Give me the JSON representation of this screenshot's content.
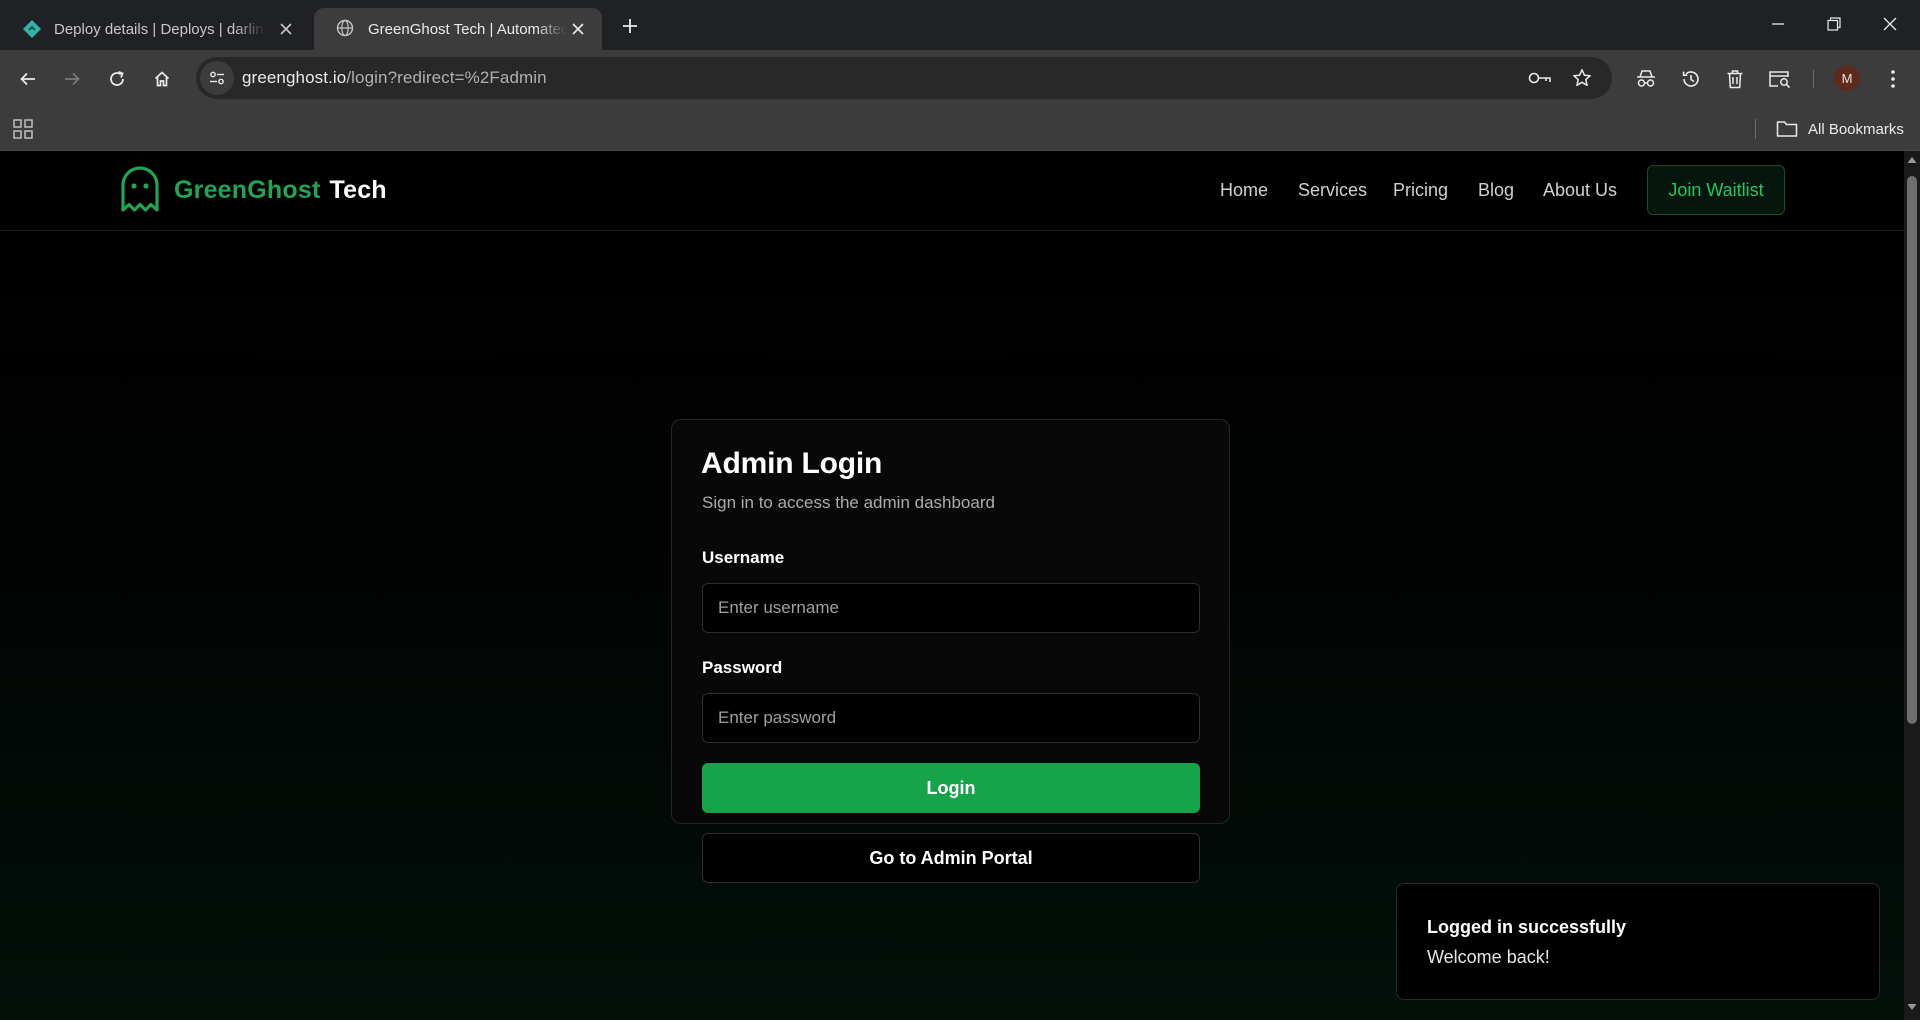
{
  "browser": {
    "tabs": [
      {
        "title": "Deploy details | Deploys | darlin",
        "favicon": "netlify-icon",
        "active": false
      },
      {
        "title": "GreenGhost Tech | Automated L",
        "favicon": "globe-icon",
        "active": true
      }
    ],
    "url_host": "greenghost.io",
    "url_path": "/login?redirect=%2Fadmin",
    "profile_initial": "M",
    "bookmarks_label": "All Bookmarks"
  },
  "site": {
    "brand_green": "GreenGhost",
    "brand_white": "Tech",
    "nav": [
      "Home",
      "Services",
      "Pricing",
      "Blog",
      "About Us"
    ],
    "cta_label": "Join Waitlist",
    "accent_color": "#16a34a"
  },
  "login": {
    "title": "Admin Login",
    "subtitle": "Sign in to access the admin dashboard",
    "username_label": "Username",
    "username_placeholder": "Enter username",
    "password_label": "Password",
    "password_placeholder": "Enter password",
    "login_button": "Login",
    "portal_button": "Go to Admin Portal"
  },
  "toast": {
    "title": "Logged in successfully",
    "description": "Welcome back!"
  }
}
